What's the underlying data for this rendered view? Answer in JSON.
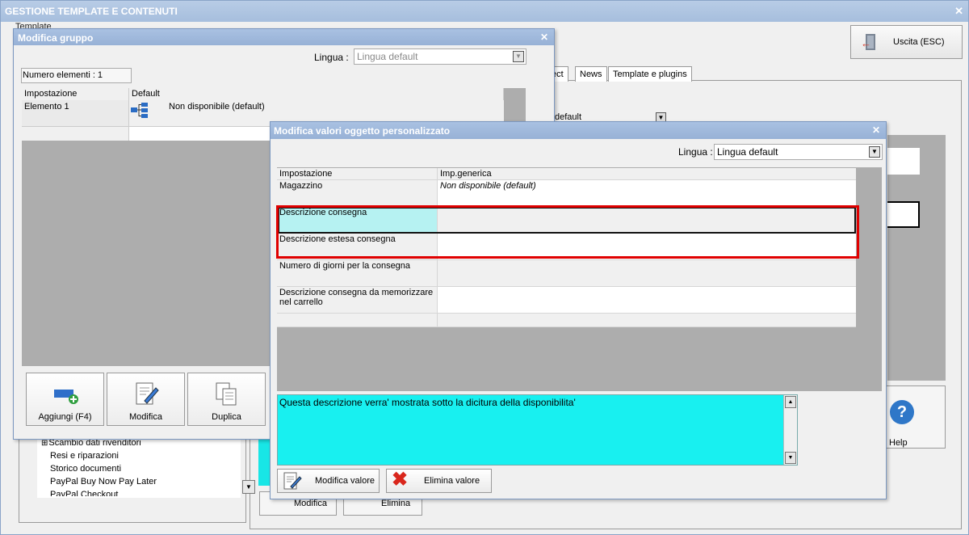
{
  "main": {
    "title": "GESTIONE TEMPLATE E CONTENUTI",
    "close": "✕",
    "menu_label": "Template",
    "exit_button": "Uscita (ESC)",
    "tabs": [
      "ect",
      "News",
      "Template e plugins"
    ],
    "combo_fragment": "default",
    "help_label": "Help",
    "tree_items": [
      {
        "label": "Scambio dati rivenditori",
        "expandable": true
      },
      {
        "label": "Resi e riparazioni",
        "expandable": false
      },
      {
        "label": "Storico documenti",
        "expandable": false
      },
      {
        "label": "PayPal Buy Now Pay Later",
        "expandable": false
      },
      {
        "label": "PayPal Checkout",
        "expandable": false
      }
    ],
    "modify_button": "Modifica",
    "delete_button": "Elimina"
  },
  "group_dialog": {
    "title": "Modifica gruppo",
    "close": "✕",
    "lingua_label": "Lingua :",
    "lingua_value": "Lingua default",
    "count_label": "Numero elementi : 1",
    "columns": [
      "Impostazione",
      "Default"
    ],
    "row": {
      "name": "Elemento 1",
      "value": "Non disponibile (default)"
    },
    "buttons": [
      "Aggiungi (F4)",
      "Modifica",
      "Duplica"
    ]
  },
  "values_dialog": {
    "title": "Modifica valori oggetto personalizzato",
    "close": "✕",
    "lingua_label": "Lingua :",
    "lingua_value": "Lingua default",
    "columns": [
      "Impostazione",
      "Imp.generica"
    ],
    "rows": [
      {
        "name": "Magazzino",
        "value": "Non disponibile (default)"
      },
      {
        "name": "Descrizione consegna",
        "value": ""
      },
      {
        "name": "Descrizione estesa consegna",
        "value": ""
      },
      {
        "name": "Numero di giorni per la consegna",
        "value": ""
      },
      {
        "name": "Descrizione consegna da memorizzare nel carrello",
        "value": ""
      }
    ],
    "description_text": "Questa descrizione verra' mostrata sotto la dicitura della disponibilita'",
    "modify_value_button": "Modifica valore",
    "delete_value_button": "Elimina valore"
  },
  "colors": {
    "title_bar": "#a9c1e2",
    "selected_cell": "#b6f2f2",
    "description_bg": "#18f0f0",
    "highlight_red": "#e00000",
    "grid_gray": "#adadad"
  }
}
